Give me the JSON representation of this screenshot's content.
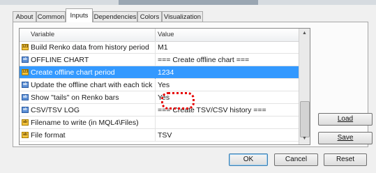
{
  "tabs": [
    {
      "label": "About"
    },
    {
      "label": "Common"
    },
    {
      "label": "Inputs"
    },
    {
      "label": "Dependencies"
    },
    {
      "label": "Colors"
    },
    {
      "label": "Visualization"
    }
  ],
  "table": {
    "headers": {
      "variable": "Variable",
      "value": "Value"
    },
    "rows": [
      {
        "variable": "Build Renko data from history period",
        "value": "M1",
        "icon": "int-param-icon"
      },
      {
        "variable": "OFFLINE CHART",
        "value": "=== Create offline chart ===",
        "icon": "section-param-icon"
      },
      {
        "variable": "Create offline chart period",
        "value": "1234",
        "icon": "int-param-icon",
        "selected": true
      },
      {
        "variable": "Update the offline chart with each tick",
        "value": "Yes",
        "icon": "bool-param-icon"
      },
      {
        "variable": "Show \"tails\" on Renko bars",
        "value": "Yes",
        "icon": "bool-param-icon"
      },
      {
        "variable": "CSV/TSV LOG",
        "value": "=== Create TSV/CSV history ===",
        "icon": "section-param-icon"
      },
      {
        "variable": "Filename to write (in MQL4\\Files)",
        "value": "",
        "icon": "string-param-icon"
      },
      {
        "variable": "File format",
        "value": "TSV",
        "icon": "enum-param-icon"
      }
    ]
  },
  "side_buttons": {
    "load": "Load",
    "save": "Save"
  },
  "bottom_buttons": {
    "ok": "OK",
    "cancel": "Cancel",
    "reset": "Reset"
  },
  "colors": {
    "selection": "#3399ff",
    "highlight_marker": "#e60000"
  }
}
